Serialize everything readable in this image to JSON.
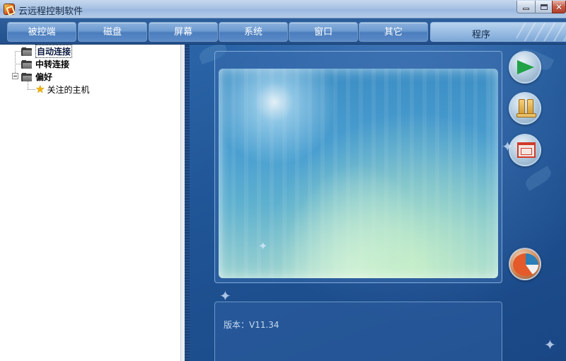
{
  "window": {
    "title": "云远程控制软件",
    "icons": {
      "app": "app-icon",
      "minimize": "minimize-icon",
      "maximize": "maximize-icon",
      "close": "close-icon"
    },
    "close_label": "✕"
  },
  "tabs": [
    {
      "label": "被控端"
    },
    {
      "label": "磁盘"
    },
    {
      "label": "屏幕"
    },
    {
      "label": "系统"
    },
    {
      "label": "窗口"
    },
    {
      "label": "其它"
    }
  ],
  "active_tab": {
    "label": "程序"
  },
  "tree": {
    "items": [
      {
        "label": "自动连接",
        "icon": "folder-icon",
        "selected": true
      },
      {
        "label": "中转连接",
        "icon": "folder-icon"
      },
      {
        "label": "偏好",
        "icon": "folder-icon",
        "expanded": true
      },
      {
        "label": "关注的主机",
        "icon": "star-icon"
      }
    ]
  },
  "main": {
    "version_text": "版本：V11.34",
    "side_buttons": [
      {
        "name": "connect",
        "icon": "play-arrow-icon"
      },
      {
        "name": "pause",
        "icon": "pause-icon"
      },
      {
        "name": "window",
        "icon": "window-icon"
      },
      {
        "name": "stats",
        "icon": "pie-chart-icon"
      }
    ]
  },
  "colors": {
    "accent": "#2b65a8",
    "tab": "#6d9ad0",
    "background": "#1d4a86"
  }
}
